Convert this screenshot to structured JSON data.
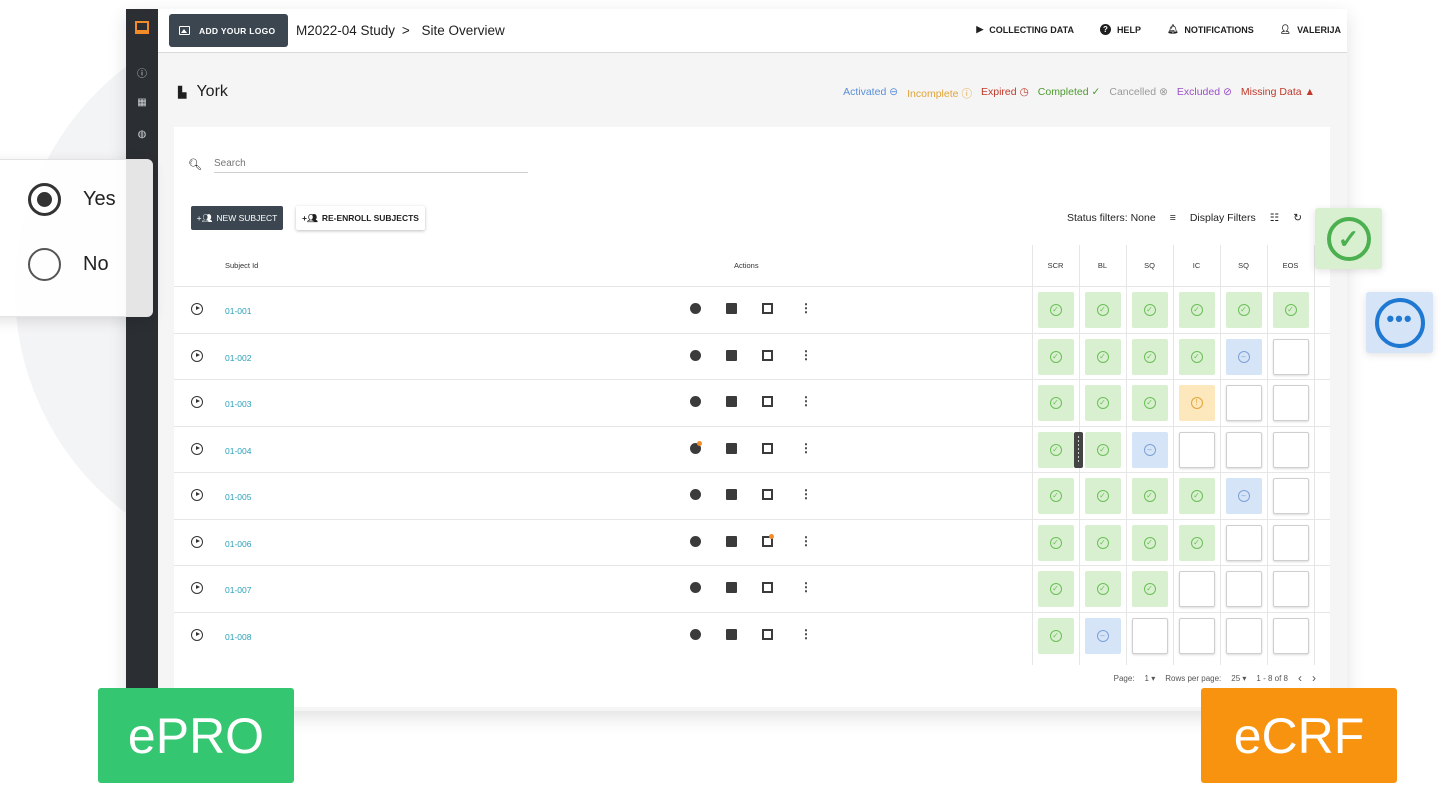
{
  "header": {
    "logo_button": "ADD YOUR LOGO",
    "breadcrumb_study": "M2022-04 Study",
    "breadcrumb_sep": ">",
    "breadcrumb_page": "Site Overview",
    "actions": [
      "COLLECTING DATA",
      "HELP",
      "NOTIFICATIONS",
      "VALERIJA"
    ]
  },
  "site": {
    "name": "York"
  },
  "legend": [
    {
      "label": "Activated",
      "icon": "⊖",
      "color": "#5b8fd6"
    },
    {
      "label": "Incomplete",
      "icon": "ⓘ",
      "color": "#e0a43a"
    },
    {
      "label": "Expired",
      "icon": "◷",
      "color": "#c0392b"
    },
    {
      "label": "Completed",
      "icon": "✓",
      "color": "#4e9a2e"
    },
    {
      "label": "Cancelled",
      "icon": "⊗",
      "color": "#9a9a9a"
    },
    {
      "label": "Excluded",
      "icon": "⊘",
      "color": "#9b4fc8"
    },
    {
      "label": "Missing Data",
      "icon": "▲",
      "color": "#c0392b"
    }
  ],
  "search": {
    "placeholder": "Search"
  },
  "buttons": {
    "new_subject": "NEW SUBJECT",
    "reenroll": "RE-ENROLL SUBJECTS"
  },
  "filters": {
    "status": "Status filters: None",
    "display": "Display Filters"
  },
  "table": {
    "col_subject": "Subject Id",
    "col_actions": "Actions",
    "visit_columns": [
      "SCR",
      "BL",
      "SQ",
      "IC",
      "SQ",
      "EOS"
    ],
    "rows": [
      {
        "id": "01-001",
        "cells": [
          "completed",
          "completed",
          "completed",
          "completed",
          "completed",
          "completed"
        ]
      },
      {
        "id": "01-002",
        "cells": [
          "completed",
          "completed",
          "completed",
          "completed",
          "activated",
          "empty"
        ]
      },
      {
        "id": "01-003",
        "cells": [
          "completed",
          "completed",
          "completed",
          "incomplete",
          "empty",
          "empty"
        ]
      },
      {
        "id": "01-004",
        "cells": [
          "completed",
          "completed",
          "activated",
          "empty",
          "empty",
          "empty"
        ]
      },
      {
        "id": "01-005",
        "cells": [
          "completed",
          "completed",
          "completed",
          "completed",
          "activated",
          "empty"
        ]
      },
      {
        "id": "01-006",
        "cells": [
          "completed",
          "completed",
          "completed",
          "completed",
          "empty",
          "empty"
        ]
      },
      {
        "id": "01-007",
        "cells": [
          "completed",
          "completed",
          "completed",
          "empty",
          "empty",
          "empty"
        ]
      },
      {
        "id": "01-008",
        "cells": [
          "completed",
          "activated",
          "empty",
          "empty",
          "empty",
          "empty"
        ]
      }
    ]
  },
  "pagination": {
    "page_label": "Page:",
    "page_value": "1",
    "rows_label": "Rows per page:",
    "rows_value": "25",
    "range": "1 - 8 of 8"
  },
  "radio_overlay": {
    "options": [
      "Yes",
      "No"
    ],
    "selected": "Yes"
  },
  "badges": {
    "left": "ePRO",
    "right": "eCRF"
  }
}
